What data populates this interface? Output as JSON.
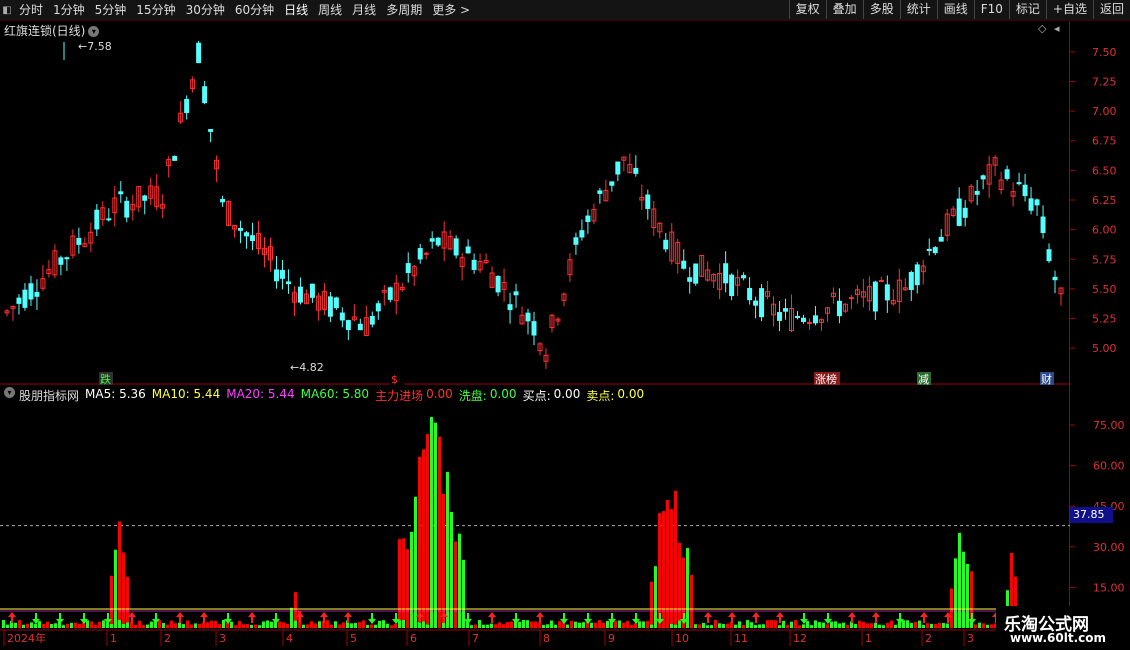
{
  "toolbar": {
    "periods": [
      "分时",
      "1分钟",
      "5分钟",
      "15分钟",
      "30分钟",
      "60分钟",
      "日线",
      "周线",
      "月线",
      "多周期",
      "更多 >"
    ],
    "active_period": "日线",
    "right_buttons": [
      "复权",
      "叠加",
      "多股",
      "统计",
      "画线",
      "F10",
      "标记",
      "+自选",
      "返回"
    ]
  },
  "main_chart": {
    "title": "红旗连锁(日线)",
    "high_label": "7.58",
    "low_label": "4.82",
    "price_axis": [
      "7.50",
      "7.25",
      "7.00",
      "6.75",
      "6.50",
      "6.25",
      "6.00",
      "5.75",
      "5.50",
      "5.25",
      "5.00"
    ],
    "events": [
      {
        "text": "跌",
        "color": "#40ff40",
        "bg": "#303030"
      },
      {
        "text": "$",
        "color": "#ff3030",
        "bg": "#000000"
      },
      {
        "text": "涨榜",
        "color": "#ffffff",
        "bg": "#8a1a1a"
      },
      {
        "text": "减",
        "color": "#ffffff",
        "bg": "#2a6a2a"
      },
      {
        "text": "财",
        "color": "#ffffff",
        "bg": "#2a4a8a"
      }
    ]
  },
  "indicator": {
    "name": "股朋指标网",
    "values": [
      {
        "label": "MA5: 5.36",
        "color": "#ffffff"
      },
      {
        "label": "MA10: 5.44",
        "color": "#ffff40"
      },
      {
        "label": "MA20: 5.44",
        "color": "#ff40ff"
      },
      {
        "label": "MA60: 5.80",
        "color": "#40ff40"
      },
      {
        "label": "主力进场",
        "color": "#ff3030"
      },
      {
        "label": "0.00",
        "color": "#ff3030"
      },
      {
        "label": "洗盘:",
        "color": "#40ff40"
      },
      {
        "label": "0.00",
        "color": "#40ff40"
      },
      {
        "label": "买点:",
        "color": "#ffffff"
      },
      {
        "label": "0.00",
        "color": "#ffffff"
      },
      {
        "label": "卖点:",
        "color": "#ffff40"
      },
      {
        "label": "0.00",
        "color": "#ffff40"
      }
    ],
    "axis": [
      "75.00",
      "60.00",
      "45.00",
      "30.00",
      "15.00"
    ],
    "current_value": "37.85"
  },
  "time_axis": [
    "2024年",
    "1",
    "2",
    "3",
    "4",
    "5",
    "6",
    "7",
    "8",
    "9",
    "10",
    "11",
    "12",
    "1",
    "2",
    "3"
  ],
  "watermark": {
    "line1": "乐淘公式网",
    "line2": "www.60lt.com"
  },
  "colors": {
    "up": "#ff3030",
    "down": "#54ffff",
    "bar_red": "#ff0000",
    "bar_green": "#20ff20"
  }
}
